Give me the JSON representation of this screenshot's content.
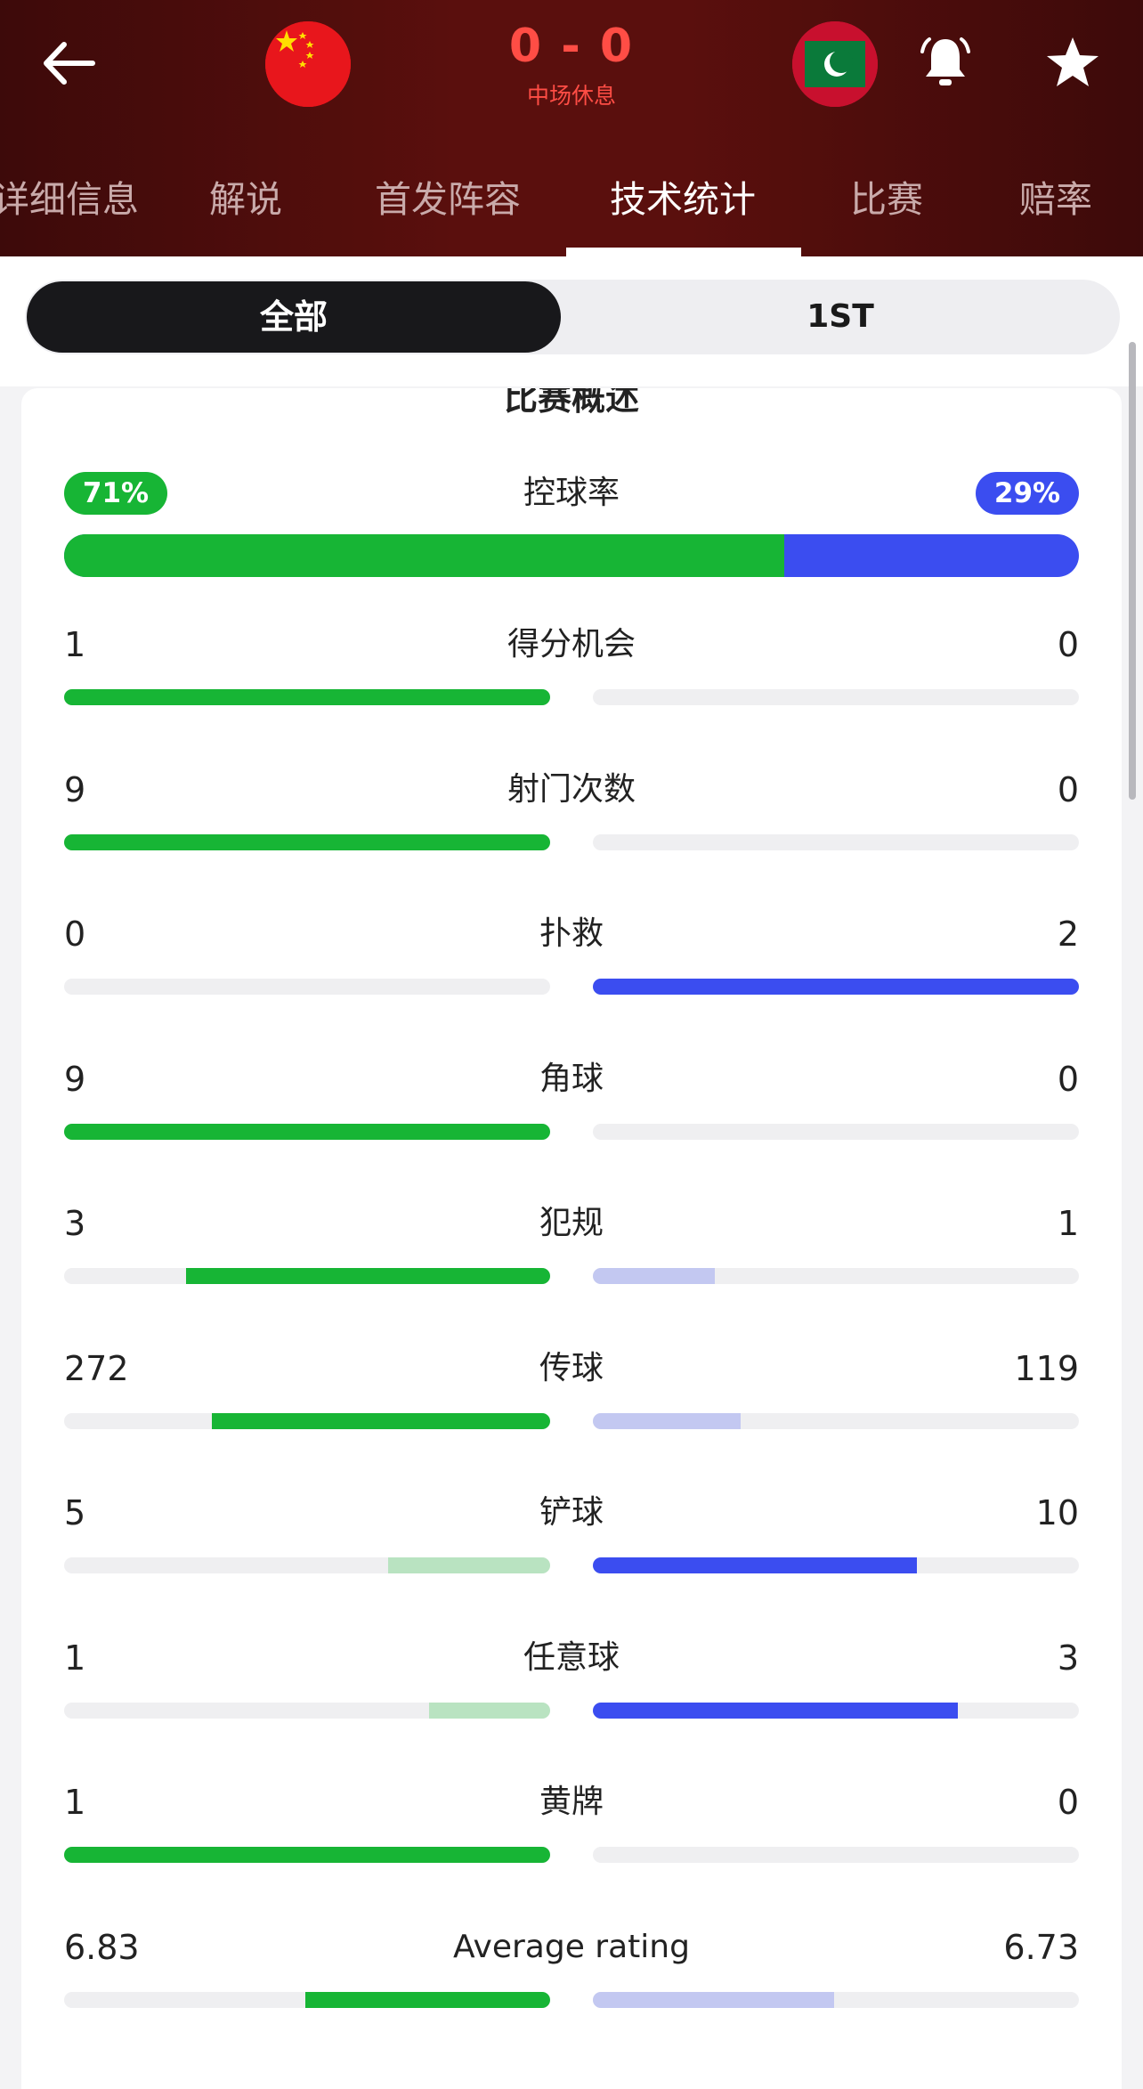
{
  "header": {
    "score": "0 - 0",
    "status": "中场休息",
    "icons": {
      "back": "back-arrow-icon",
      "home_flag": "china-flag-icon",
      "away_flag": "maldives-flag-icon",
      "bell": "notification-bell-icon",
      "star": "favorite-star-icon"
    },
    "tabs": [
      {
        "label": "详细信息"
      },
      {
        "label": "解说"
      },
      {
        "label": "首发阵容"
      },
      {
        "label": "技术统计"
      },
      {
        "label": "比赛"
      },
      {
        "label": "赔率"
      }
    ],
    "active_tab": 3
  },
  "segment": {
    "all": "全部",
    "first": "1ST",
    "selected": "all"
  },
  "overview": {
    "title": "比赛概述",
    "possession": {
      "label": "控球率",
      "home": "71%",
      "away": "29%",
      "home_value": 71,
      "away_value": 29
    }
  },
  "stats": [
    {
      "label": "得分机会",
      "home": "1",
      "away": "0",
      "home_value": 1,
      "away_value": 0
    },
    {
      "label": "射门次数",
      "home": "9",
      "away": "0",
      "home_value": 9,
      "away_value": 0
    },
    {
      "label": "扑救",
      "home": "0",
      "away": "2",
      "home_value": 0,
      "away_value": 2
    },
    {
      "label": "角球",
      "home": "9",
      "away": "0",
      "home_value": 9,
      "away_value": 0
    },
    {
      "label": "犯规",
      "home": "3",
      "away": "1",
      "home_value": 3,
      "away_value": 1
    },
    {
      "label": "传球",
      "home": "272",
      "away": "119",
      "home_value": 272,
      "away_value": 119
    },
    {
      "label": "铲球",
      "home": "5",
      "away": "10",
      "home_value": 5,
      "away_value": 10
    },
    {
      "label": "任意球",
      "home": "1",
      "away": "3",
      "home_value": 1,
      "away_value": 3
    },
    {
      "label": "黄牌",
      "home": "1",
      "away": "0",
      "home_value": 1,
      "away_value": 0
    },
    {
      "label": "Average rating",
      "home": "6.83",
      "away": "6.73",
      "home_value": 6.83,
      "away_value": 6.73
    }
  ],
  "colors": {
    "home_strong": "#17b535",
    "home_light": "#b9e3c1",
    "away_strong": "#3b4df0",
    "away_light": "#c3c8f1",
    "score_red": "#ff4d45"
  }
}
